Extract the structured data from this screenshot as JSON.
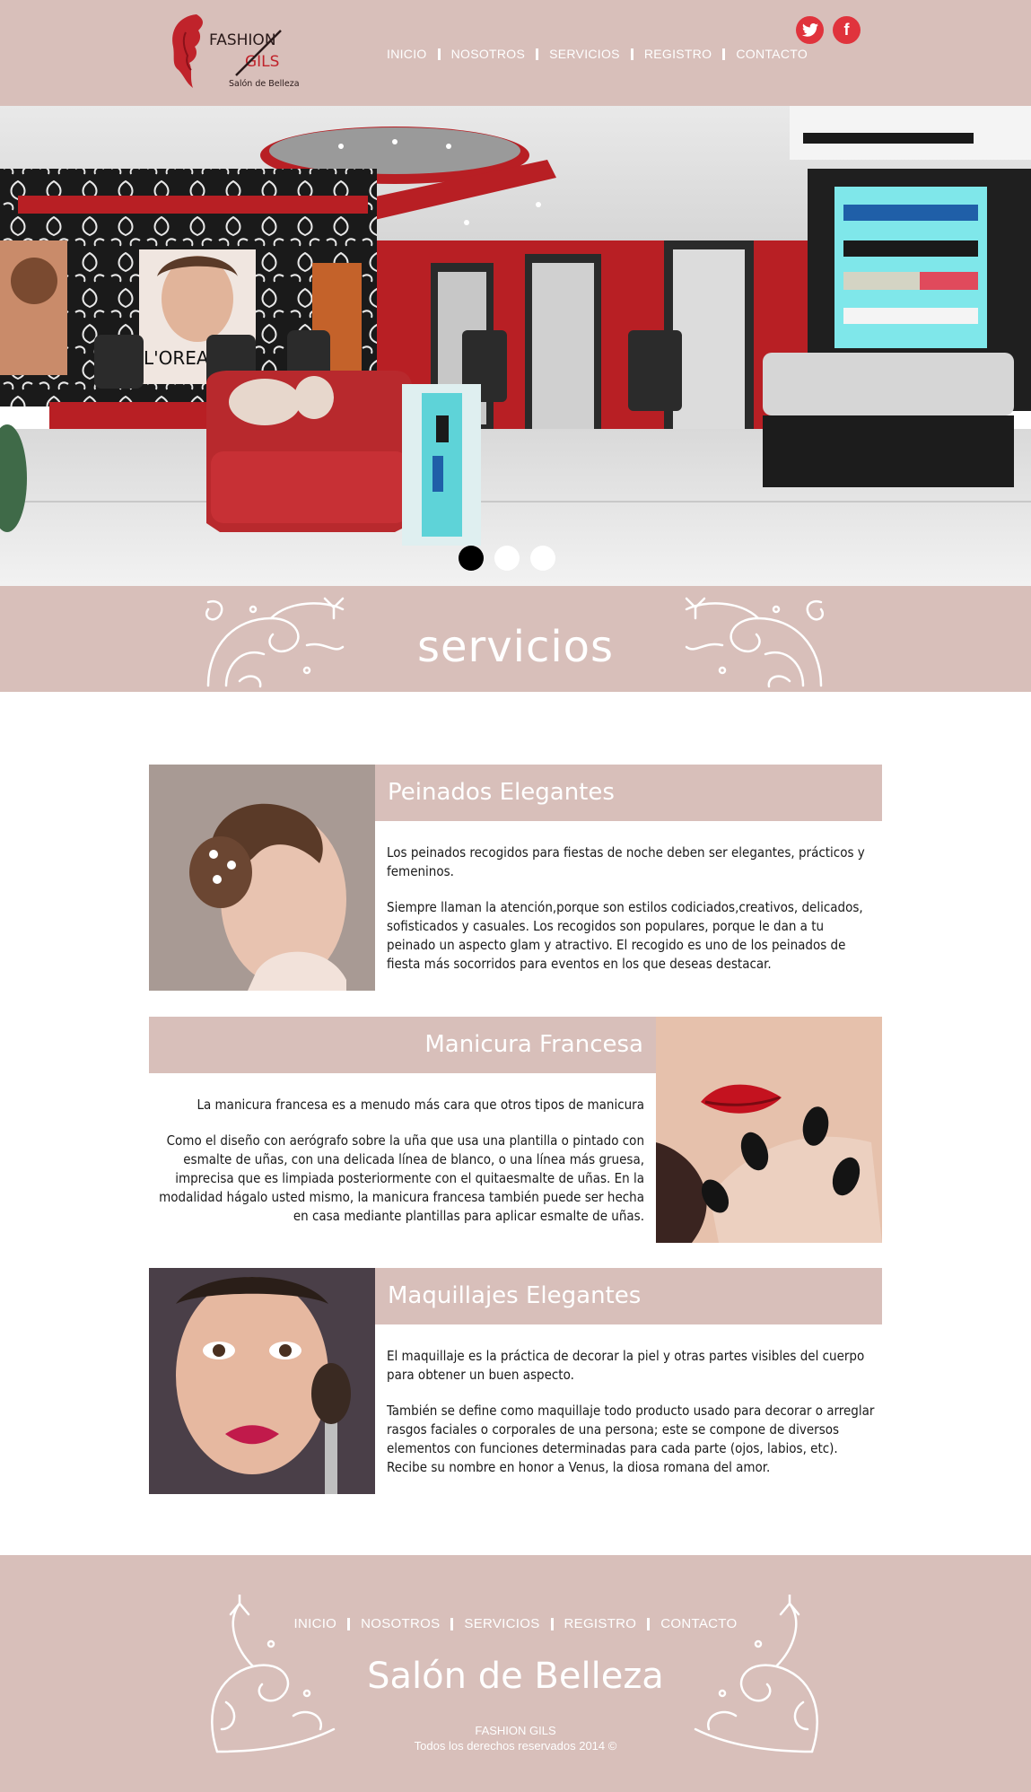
{
  "header": {
    "logo": {
      "brand_line1": "FASHION",
      "brand_line2": "GILS",
      "tagline": "Salón de Belleza"
    },
    "nav": [
      {
        "label": "INICIO"
      },
      {
        "label": "NOSOTROS"
      },
      {
        "label": "SERVICIOS"
      },
      {
        "label": "REGISTRO"
      },
      {
        "label": "CONTACTO"
      }
    ],
    "social": {
      "twitter_icon": "twitter-icon",
      "facebook_icon": "facebook-icon",
      "facebook_glyph": "f"
    }
  },
  "hero": {
    "image": "salon-interior",
    "slides_total": 3,
    "active_slide": 1,
    "poster_text": "L'OREAL"
  },
  "section": {
    "title": "servicios"
  },
  "services": [
    {
      "title": "Peinados Elegantes",
      "image": "woman-updo-hairstyle",
      "paragraphs": [
        "Los peinados recogidos para fiestas de noche deben ser elegantes, prácticos y femeninos.",
        "Siempre llaman la atención,porque son estilos codiciados,creativos, delicados, sofisticados y casuales. Los recogidos son populares, porque le dan a tu peinado un aspecto glam y atractivo. El recogido es uno de los peinados de fiesta más socorridos para eventos en los que deseas destacar."
      ]
    },
    {
      "title": "Manicura Francesa",
      "image": "red-lips-black-nails",
      "paragraphs": [
        "La manicura francesa es a menudo más cara que otros tipos de manicura",
        "Como el diseño con aerógrafo sobre la uña que usa una plantilla o pintado con esmalte de uñas, con una delicada línea de blanco, o una línea más gruesa, imprecisa que es limpiada posteriormente con el quitaesmalte de uñas. En la modalidad hágalo usted mismo, la manicura francesa también puede ser hecha en casa mediante plantillas para aplicar esmalte de uñas."
      ]
    },
    {
      "title": "Maquillajes Elegantes",
      "image": "woman-makeup-brush",
      "paragraphs": [
        "El maquillaje es la práctica de decorar la piel y otras partes visibles del cuerpo para obtener un buen aspecto.",
        "También se define como maquillaje todo producto usado para decorar o arreglar rasgos faciales o corporales de una persona; este se compone de diversos elementos con funciones determinadas para cada parte (ojos, labios, etc). Recibe su nombre en honor a Venus, la diosa romana del amor."
      ]
    }
  ],
  "footer": {
    "nav": [
      {
        "label": "INICIO"
      },
      {
        "label": "NOSOTROS"
      },
      {
        "label": "SERVICIOS"
      },
      {
        "label": "REGISTRO"
      },
      {
        "label": "CONTACTO"
      }
    ],
    "title": "Salón de Belleza",
    "brand": "FASHION GILS",
    "copyright": "Todos los derechos reservados 2014 ©"
  },
  "colors": {
    "accent": "#d8bfba",
    "social": "#e0333c",
    "salon_red": "#b81f24"
  }
}
